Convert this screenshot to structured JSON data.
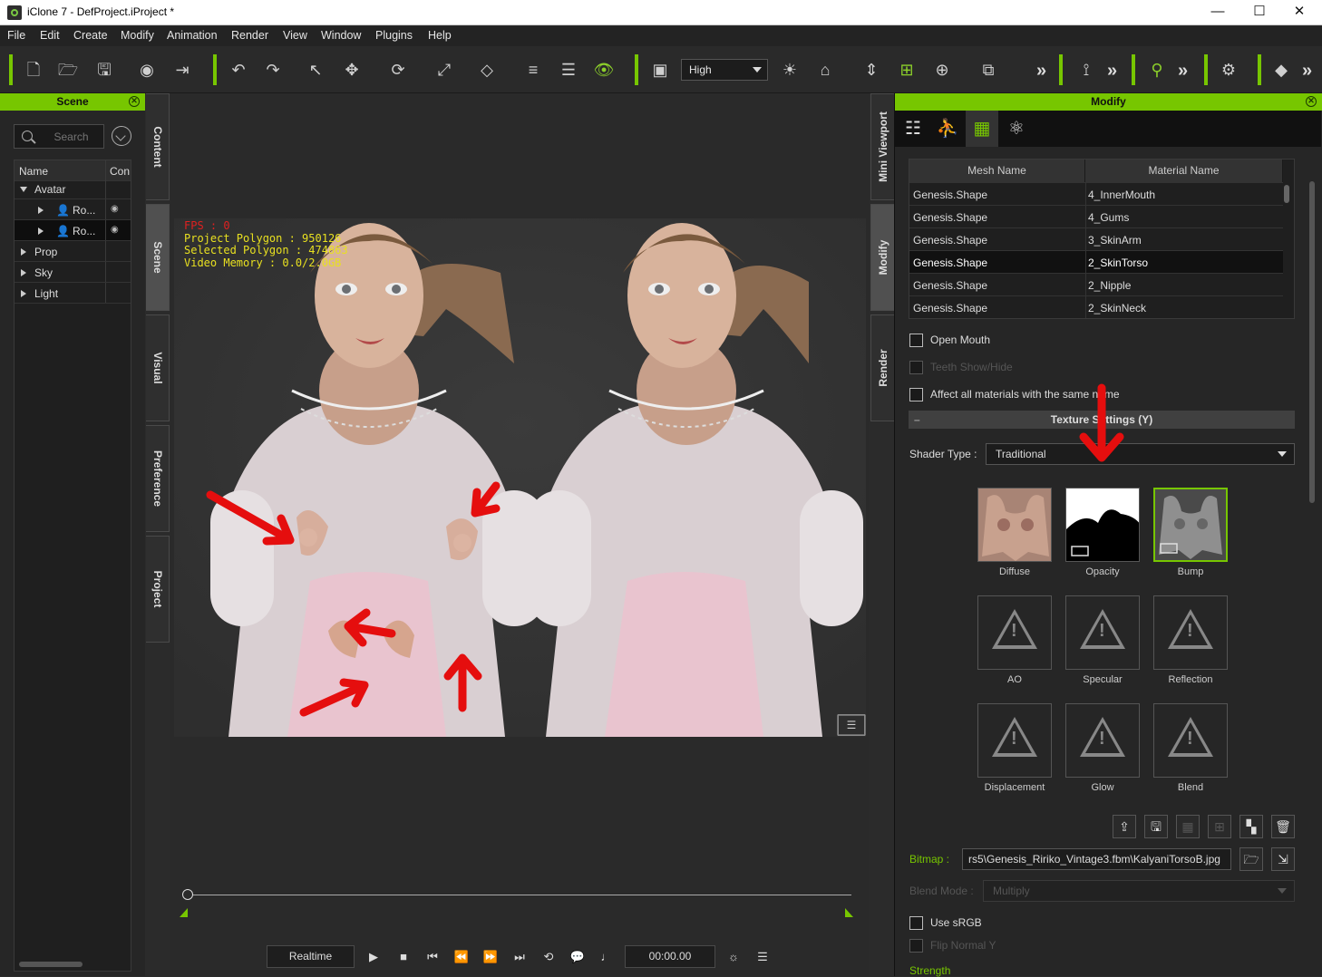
{
  "window": {
    "title": "iClone 7 - DefProject.iProject *",
    "minimize": "—",
    "maximize": "☐",
    "close": "✕"
  },
  "menu": [
    "File",
    "Edit",
    "Create",
    "Modify",
    "Animation",
    "Render",
    "View",
    "Window",
    "Plugins",
    "Help"
  ],
  "toolbar": {
    "quality": "High",
    "more": "»"
  },
  "scene_panel": {
    "title": "Scene",
    "search_placeholder": "Search",
    "columns": [
      "Name",
      "Con"
    ],
    "tree": [
      {
        "label": "Avatar"
      },
      {
        "label": "Ro..."
      },
      {
        "label": "Ro..."
      },
      {
        "label": "Prop"
      },
      {
        "label": "Sky"
      },
      {
        "label": "Light"
      }
    ]
  },
  "side_tabs": [
    "Content",
    "Scene",
    "Visual",
    "Preference",
    "Project"
  ],
  "right_tabs": [
    "Mini Viewport",
    "Modify",
    "Render"
  ],
  "viewport": {
    "fps": "FPS : 0",
    "polygon": "Project Polygon : 950126",
    "selected": "Selected Polygon : 474863",
    "memory": "Video Memory : 0.0/2.0GB"
  },
  "playback": {
    "mode": "Realtime",
    "time": "00:00.00"
  },
  "modify_panel": {
    "title": "Modify",
    "table_headers": [
      "Mesh Name",
      "Material Name"
    ],
    "rows": [
      {
        "mesh": "Genesis.Shape",
        "material": "4_InnerMouth"
      },
      {
        "mesh": "Genesis.Shape",
        "material": "4_Gums"
      },
      {
        "mesh": "Genesis.Shape",
        "material": "3_SkinArm"
      },
      {
        "mesh": "Genesis.Shape",
        "material": "2_SkinTorso"
      },
      {
        "mesh": "Genesis.Shape",
        "material": "2_Nipple"
      },
      {
        "mesh": "Genesis.Shape",
        "material": "2_SkinNeck"
      }
    ],
    "open_mouth": "Open Mouth",
    "teeth": "Teeth Show/Hide",
    "affect_all": "Affect all materials with the same name",
    "texture_settings": "Texture Settings  (Y)",
    "collapse": "–",
    "shader_label": "Shader Type :",
    "shader_value": "Traditional",
    "slots": [
      "Diffuse",
      "Opacity",
      "Bump",
      "AO",
      "Specular",
      "Reflection",
      "Displacement",
      "Glow",
      "Blend"
    ],
    "bitmap_label": "Bitmap :",
    "bitmap_value": "rs5\\Genesis_Ririko_Vintage3.fbm\\KalyaniTorsoB.jpg",
    "blend_label": "Blend Mode :",
    "blend_value": "Multiply",
    "use_srgb": "Use sRGB",
    "flip_normal": "Flip Normal Y",
    "strength": "Strength"
  },
  "colors": {
    "accent": "#77c600",
    "annotation": "#e50e0e"
  }
}
